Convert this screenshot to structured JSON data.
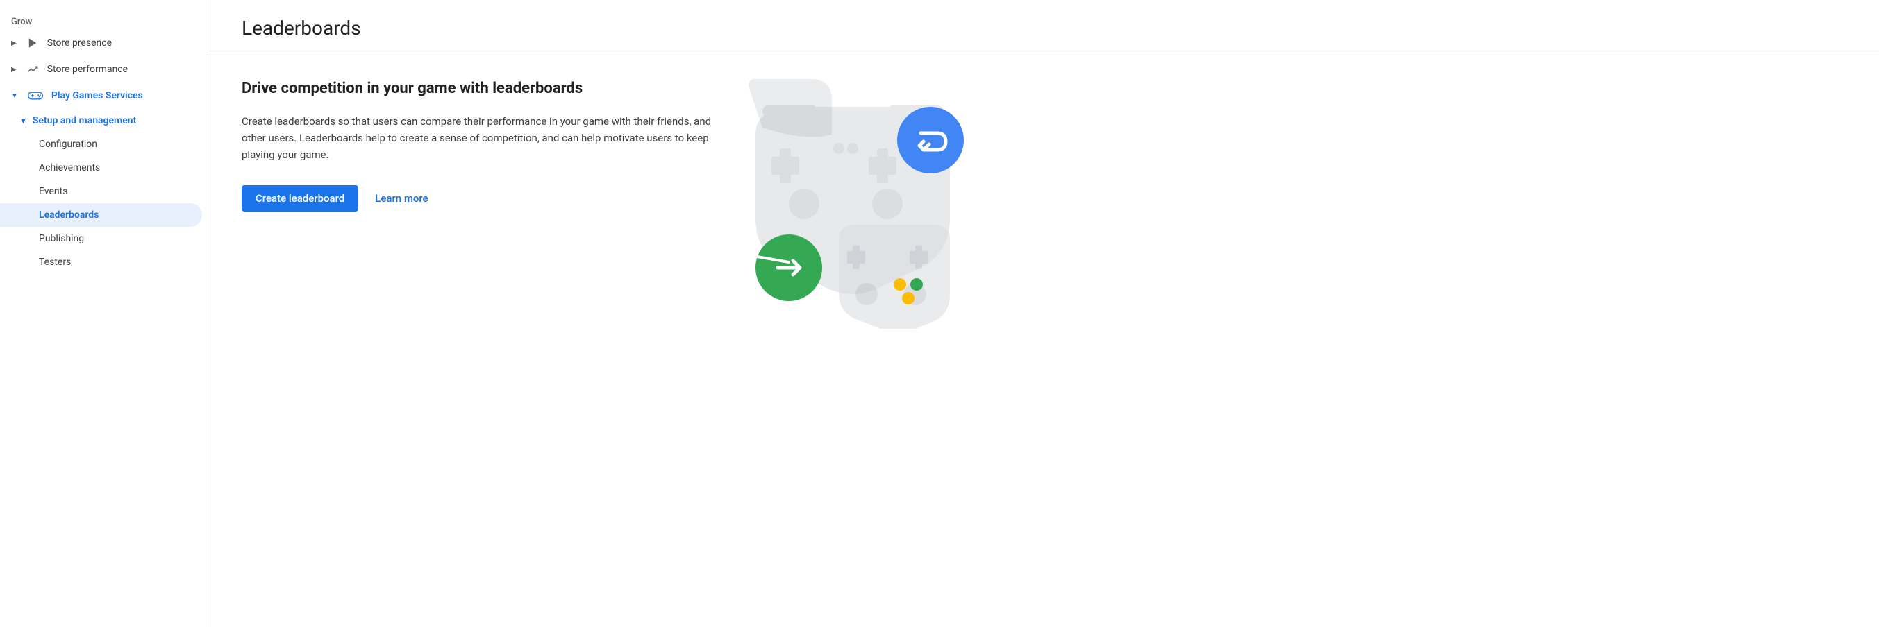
{
  "sidebar": {
    "grow_label": "Grow",
    "items": [
      {
        "id": "store-presence",
        "label": "Store presence",
        "icon": "play-icon",
        "expandable": true,
        "expanded": false
      },
      {
        "id": "store-performance",
        "label": "Store performance",
        "icon": "trending-icon",
        "expandable": true,
        "expanded": false
      },
      {
        "id": "play-games-services",
        "label": "Play Games Services",
        "icon": "gamepad-icon",
        "expandable": true,
        "expanded": true,
        "blue": true
      }
    ],
    "sub_section_label": "Setup and management",
    "sub_items": [
      {
        "id": "configuration",
        "label": "Configuration"
      },
      {
        "id": "achievements",
        "label": "Achievements"
      },
      {
        "id": "events",
        "label": "Events"
      },
      {
        "id": "leaderboards",
        "label": "Leaderboards",
        "active": true
      },
      {
        "id": "publishing",
        "label": "Publishing"
      },
      {
        "id": "testers",
        "label": "Testers"
      }
    ]
  },
  "page": {
    "title": "Leaderboards",
    "heading": "Drive competition in your game with leaderboards",
    "description": "Create leaderboards so that users can compare their performance in your game with their friends, and other users. Leaderboards help to create a sense of competition, and can help motivate users to keep playing your game.",
    "create_button": "Create leaderboard",
    "learn_more": "Learn more"
  },
  "colors": {
    "blue": "#1a73e8",
    "green": "#34a853",
    "yellow": "#fbbc04",
    "gray_light": "#dadce0",
    "gray_mid": "#bdc1c6",
    "icon_blue": "#4285f4"
  }
}
